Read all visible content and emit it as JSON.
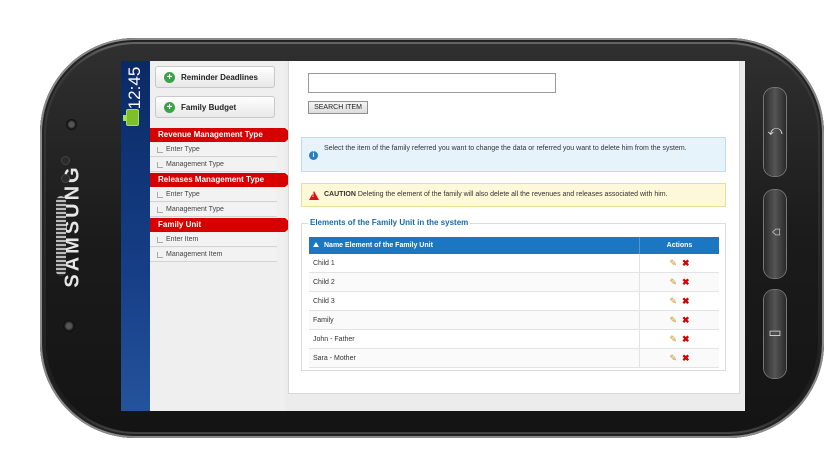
{
  "device": {
    "brand": "SAMSUNG",
    "clock": "12:45"
  },
  "sidebar": {
    "buttons": [
      {
        "label": "Reminder Deadlines"
      },
      {
        "label": "Family Budget"
      }
    ],
    "sections": [
      {
        "title": "Revenue Management Type",
        "items": [
          "Enter Type",
          "Management Type"
        ]
      },
      {
        "title": "Releases Management Type",
        "items": [
          "Enter Type",
          "Management Type"
        ]
      },
      {
        "title": "Family Unit",
        "items": [
          "Enter Item",
          "Management Item"
        ]
      }
    ]
  },
  "search": {
    "value": "",
    "button_label": "SEARCH ITEM"
  },
  "info": {
    "text": "Select the item of the family referred you want to change the data or referred you want to delete him from the system."
  },
  "caution": {
    "label": "CAUTION",
    "text": "Deleting the element of the family will also delete all the revenues and releases associated with him."
  },
  "table": {
    "legend": "Elements of the Family Unit in the system",
    "columns": [
      "Name Element of the Family Unit",
      "Actions"
    ],
    "rows": [
      "Child 1",
      "Child 2",
      "Child 3",
      "Family",
      "John - Father",
      "Sara - Mother"
    ]
  },
  "colors": {
    "accent": "#1b77c2",
    "section_red": "#d70000",
    "status_bar": "#163e86"
  }
}
